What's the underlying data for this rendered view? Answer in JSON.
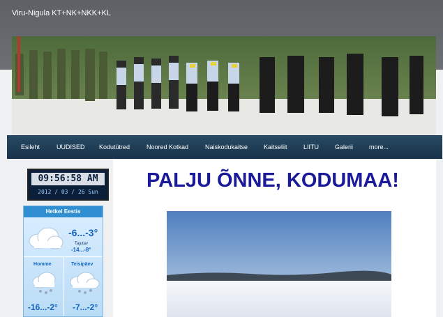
{
  "site": {
    "title": "Viru-Nigula KT+NK+NKK+KL"
  },
  "nav": {
    "items": [
      {
        "label": "Esileht"
      },
      {
        "label": "UUDISED"
      },
      {
        "label": "Kodutütred"
      },
      {
        "label": "Noored Kotkad"
      },
      {
        "label": "Naiskodukaitse"
      },
      {
        "label": "Kaitseliit"
      },
      {
        "label": "LIITU"
      },
      {
        "label": "Galerii"
      },
      {
        "label": "more..."
      }
    ]
  },
  "clock": {
    "time": "09:56:58 AM",
    "date": "2012 / 03 / 26  Sun"
  },
  "weather": {
    "header": "Hetkel Eestis",
    "current_temp": "-6...-3°",
    "feels_label": "Tajutav",
    "feels_temp": "-14...-8°",
    "tomorrow_label": "Homme",
    "tomorrow_temp": "-16...-2°",
    "dayafter_label": "Teisipäev",
    "dayafter_temp": "-7...-2°"
  },
  "main": {
    "headline": "PALJU ÕNNE, KODUMAA!"
  },
  "colors": {
    "nav_bg": "#1e3d57",
    "headline": "#1a1a9a",
    "topbar": "#63676c",
    "weather_head": "#2f8fd0"
  }
}
